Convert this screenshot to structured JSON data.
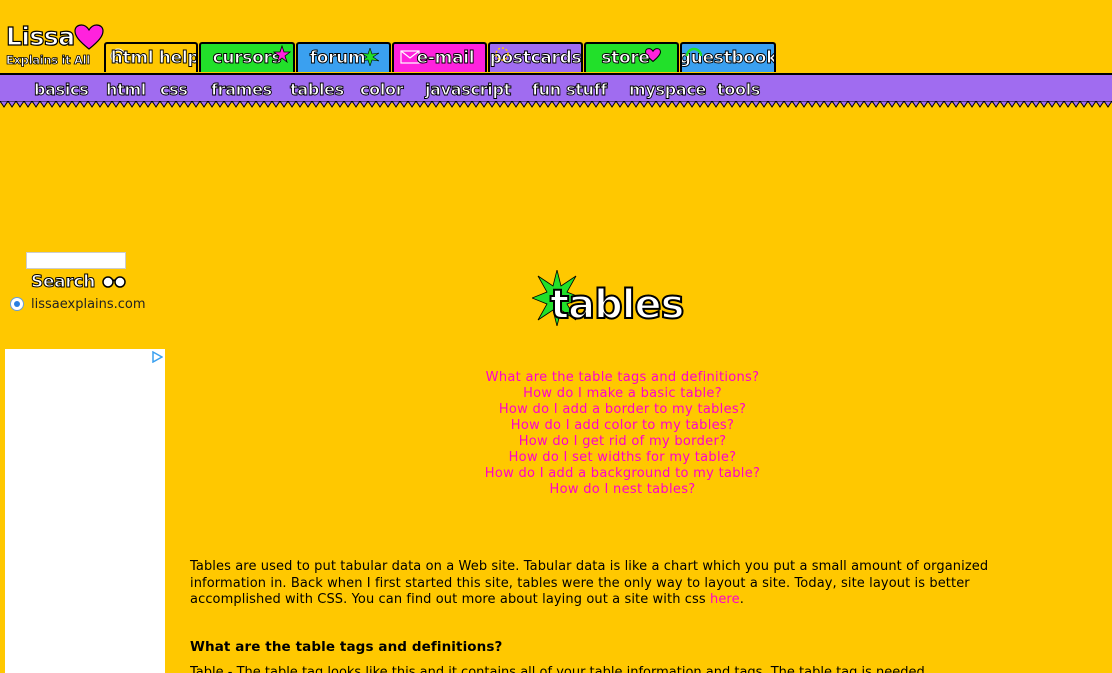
{
  "logo": {
    "name": "Lissa",
    "tagline": "Explains it All"
  },
  "tabs": [
    {
      "label": "html help",
      "color": "#ffc800"
    },
    {
      "label": "cursors",
      "color": "#22e02a"
    },
    {
      "label": "forum",
      "color": "#3aa0f0"
    },
    {
      "label": "e-mail",
      "color": "#ff22dd"
    },
    {
      "label": "postcards",
      "color": "#a06cf0"
    },
    {
      "label": "store",
      "color": "#22e02a"
    },
    {
      "label": "guestbook",
      "color": "#3aa0f0"
    }
  ],
  "subnav": [
    {
      "label": "basics"
    },
    {
      "label": "html"
    },
    {
      "label": "css"
    },
    {
      "label": "frames"
    },
    {
      "label": "tables"
    },
    {
      "label": "color"
    },
    {
      "label": "javascript"
    },
    {
      "label": "fun stuff"
    },
    {
      "label": "myspace"
    },
    {
      "label": "tools"
    }
  ],
  "search": {
    "input_value": "",
    "button_label": "Search",
    "site_option": "lissaexplains.com"
  },
  "page": {
    "heading": "tables",
    "questions": [
      "What are the table tags and definitions?",
      "How do I make a basic table?",
      "How do I add a border to my tables?",
      "How do I add color to my tables?",
      "How do I get rid of my border?",
      "How do I set widths for my table?",
      "How do I add a background to my table?",
      "How do I nest tables?"
    ],
    "intro_text": "Tables are used to put tabular data on a Web site. Tabular data is like a chart which you put a small amount of organized information in. Back when I first started this site, tables were the only way to layout a site. Today, site layout is better accomplished with CSS. You can find out more about laying out a site with css ",
    "intro_link": "here",
    "intro_end": ".",
    "section_heading": "What are the table tags and definitions?",
    "cut_text": "Table - The table tag looks like this and it contains all of your table information and tags. The table tag is needed."
  },
  "colors": {
    "background": "#ffc800",
    "link": "#ff00cc",
    "subnav": "#a06cf0"
  }
}
